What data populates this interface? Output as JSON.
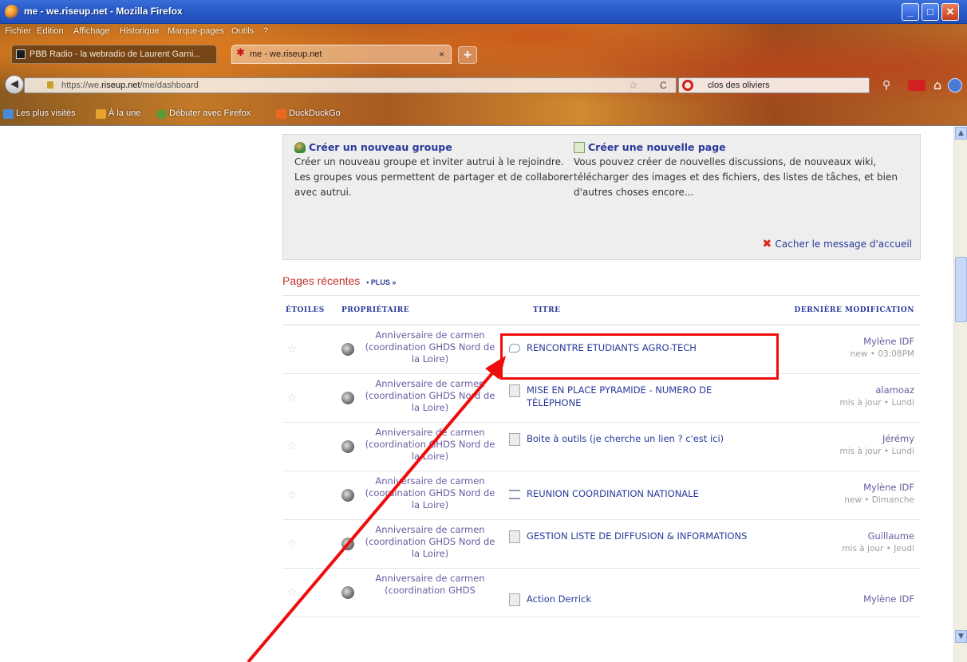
{
  "window": {
    "title": "me - we.riseup.net - Mozilla Firefox",
    "controls": {
      "minimize": "_",
      "maximize": "□",
      "close": "✕"
    }
  },
  "menubar": [
    "Fichier",
    "Edition",
    "Affichage",
    "Historique",
    "Marque-pages",
    "Outils",
    "?"
  ],
  "tabs": [
    {
      "label": "PBB Radio - la webradio de Laurent Garni...",
      "active": false
    },
    {
      "label": "me - we.riseup.net",
      "active": true,
      "close": "×"
    }
  ],
  "new_tab": "+",
  "navbar": {
    "back": "◀",
    "url_prefix": "https://we.",
    "url_domain": "riseup.net",
    "url_suffix": "/me/dashboard",
    "star": "☆",
    "reload": "C",
    "search_value": "clos des oliviers",
    "search_icon": "search-icon",
    "home_icon": "⌂"
  },
  "bookmarks": [
    "Les plus visités",
    "À la une",
    "Débuter avec Firefox",
    "DuckDuckGo"
  ],
  "welcome": {
    "group_link": "Créer un nouveau groupe",
    "group_desc": "Créer un nouveau groupe et inviter autrui à le rejoindre. Les groupes vous permettent de partager et de collaborer avec autrui.",
    "page_link": "Créer une nouvelle page",
    "page_desc": "Vous pouvez créer de nouvelles discussions, de nouveaux wiki, télécharger des images et des fichiers, des listes de tâches, et bien d'autres choses encore...",
    "hide_label": "Cacher le message d'accueil"
  },
  "recent": {
    "heading": "Pages récentes",
    "more": "• PLUS »",
    "columns": {
      "stars": "ÉTOILES",
      "owner": "PROPRIÉTAIRE",
      "title": "TITRE",
      "modified": "DERNIÈRE MODIFICATION"
    },
    "rows": [
      {
        "owner": "Anniversaire de carmen (coordination GHDS Nord de la Loire)",
        "title": "RENCONTRE ETUDIANTS AGRO-TECH",
        "type": "discussion",
        "user": "Mylène IDF",
        "meta": "new • 03:08PM"
      },
      {
        "owner": "Anniversaire de carmen (coordination GHDS Nord de la Loire)",
        "title": "MISE EN PLACE PYRAMIDE - NUMERO DE TÉLÉPHONE",
        "type": "page",
        "user": "alamoaz",
        "meta": "mis à jour • Lundi"
      },
      {
        "owner": "Anniversaire de carmen (coordination GHDS Nord de la Loire)",
        "title": "Boite à outils (je cherche un lien ? c'est ici)",
        "type": "page",
        "user": "Jérémy",
        "meta": "mis à jour • Lundi"
      },
      {
        "owner": "Anniversaire de carmen (coordination GHDS Nord de la Loire)",
        "title": "REUNION COORDINATION NATIONALE",
        "type": "list",
        "user": "Mylène IDF",
        "meta": "new • Dimanche"
      },
      {
        "owner": "Anniversaire de carmen (coordination GHDS Nord de la Loire)",
        "title": "GESTION LISTE DE DIFFUSION & INFORMATIONS",
        "type": "page",
        "user": "Guillaume",
        "meta": "mis à jour • Jeudi"
      },
      {
        "owner": "Anniversaire de carmen (coordination GHDS",
        "title": "Action Derrick",
        "type": "page",
        "user": "Mylène IDF",
        "meta": ""
      }
    ]
  },
  "colors": {
    "link": "#2a3a9a",
    "owner": "#6a5aa0",
    "heading": "#c0302a",
    "annotation": "#ee0d0d"
  }
}
